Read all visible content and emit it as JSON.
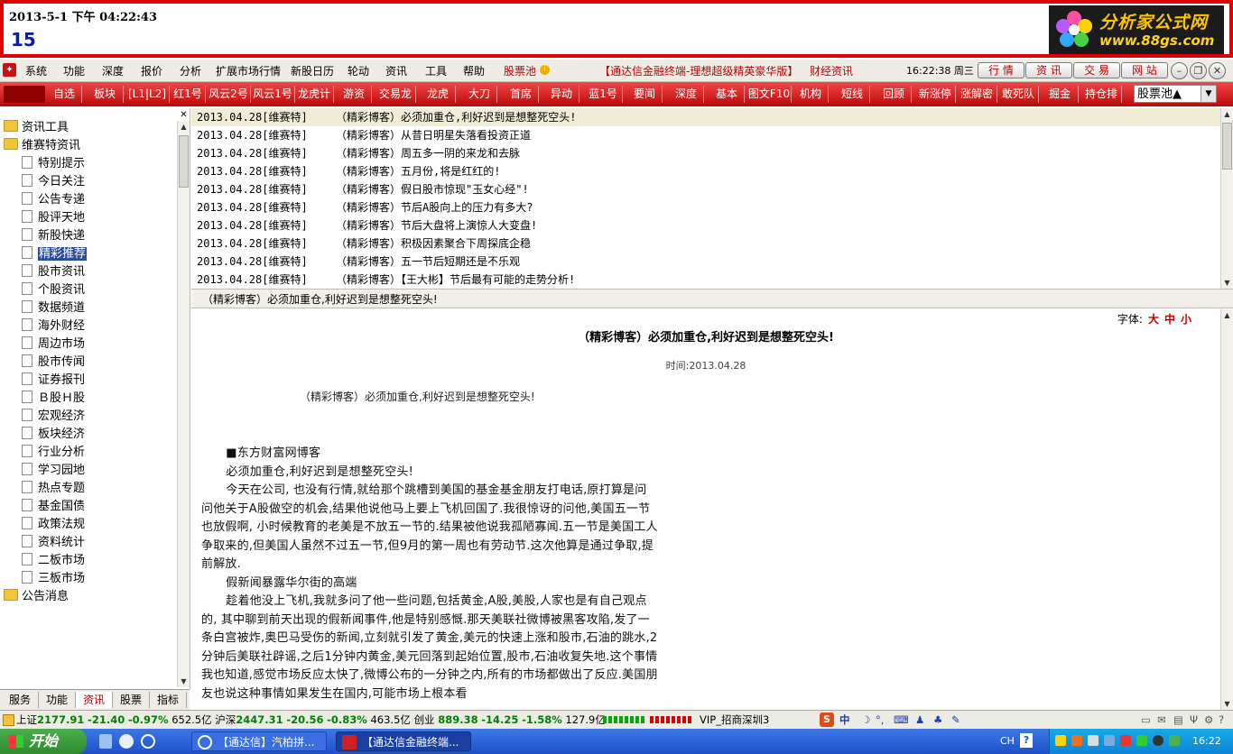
{
  "banner": {
    "datetime": "2013-5-1 下午 04:22:43",
    "number": "15",
    "logo_title": "分析家公式网",
    "logo_url": "www.88gs.com"
  },
  "menubar": {
    "items": [
      "系统",
      "功能",
      "深度",
      "报价",
      "分析",
      "扩展市场行情",
      "新股日历",
      "轮动",
      "资讯",
      "工具",
      "帮助"
    ],
    "stock_pool": "股票池",
    "app_title": "【通达信金融终端-理想超级精英豪华版】",
    "finance_news": "财经资讯",
    "clock": "16:22:38 周三",
    "nav": [
      "行 情",
      "资 讯",
      "交 易",
      "网 站"
    ]
  },
  "toolbar": {
    "items": [
      "自选",
      "板块",
      "[L1|L2]",
      "红1号",
      "风云2号",
      "风云1号",
      "龙虎计",
      "游资",
      "交易龙",
      "龙虎",
      "大刀",
      "首席",
      "异动",
      "蓝1号",
      "要闻",
      "深度",
      "基本",
      "图文F10",
      "机构",
      "短线",
      "回顾",
      "新涨停",
      "涨解密",
      "敢死队",
      "掘金",
      "持仓排"
    ],
    "stock_pool_dropdown": "股票池▲"
  },
  "tree": {
    "nodes": [
      {
        "label": "资讯工具",
        "type": "folder",
        "level": 0
      },
      {
        "label": "维赛特资讯",
        "type": "folder",
        "level": 0
      },
      {
        "label": "特别提示",
        "type": "doc",
        "level": 1
      },
      {
        "label": "今日关注",
        "type": "doc",
        "level": 1
      },
      {
        "label": "公告专递",
        "type": "doc",
        "level": 1
      },
      {
        "label": "股评天地",
        "type": "doc",
        "level": 1
      },
      {
        "label": "新股快递",
        "type": "doc",
        "level": 1
      },
      {
        "label": "精彩推荐",
        "type": "doc",
        "level": 1,
        "selected": true
      },
      {
        "label": "股市资讯",
        "type": "doc",
        "level": 1
      },
      {
        "label": "个股资讯",
        "type": "doc",
        "level": 1
      },
      {
        "label": "数据频道",
        "type": "doc",
        "level": 1
      },
      {
        "label": "海外财经",
        "type": "doc",
        "level": 1
      },
      {
        "label": "周边市场",
        "type": "doc",
        "level": 1
      },
      {
        "label": "股市传闻",
        "type": "doc",
        "level": 1
      },
      {
        "label": "证券报刊",
        "type": "doc",
        "level": 1
      },
      {
        "label": "Ｂ股Ｈ股",
        "type": "doc",
        "level": 1
      },
      {
        "label": "宏观经济",
        "type": "doc",
        "level": 1
      },
      {
        "label": "板块经济",
        "type": "doc",
        "level": 1
      },
      {
        "label": "行业分析",
        "type": "doc",
        "level": 1
      },
      {
        "label": "学习园地",
        "type": "doc",
        "level": 1
      },
      {
        "label": "热点专题",
        "type": "doc",
        "level": 1
      },
      {
        "label": "基金国债",
        "type": "doc",
        "level": 1
      },
      {
        "label": "政策法规",
        "type": "doc",
        "level": 1
      },
      {
        "label": "资料统计",
        "type": "doc",
        "level": 1
      },
      {
        "label": "二板市场",
        "type": "doc",
        "level": 1
      },
      {
        "label": "三板市场",
        "type": "doc",
        "level": 1
      },
      {
        "label": "公告消息",
        "type": "folder",
        "level": 0
      }
    ]
  },
  "bottom_tabs": [
    "服务",
    "功能",
    "资讯",
    "股票",
    "指标"
  ],
  "headlines": [
    {
      "date": "2013.04.28[维赛特]",
      "title": "（精彩博客）必须加重仓,利好迟到是想整死空头!"
    },
    {
      "date": "2013.04.28[维赛特]",
      "title": "（精彩博客）从昔日明星失落看投资正道"
    },
    {
      "date": "2013.04.28[维赛特]",
      "title": "（精彩博客）周五多一阴的来龙和去脉"
    },
    {
      "date": "2013.04.28[维赛特]",
      "title": "（精彩博客）五月份,将是红红的!"
    },
    {
      "date": "2013.04.28[维赛特]",
      "title": "（精彩博客）假日股市惊现\"玉女心经\"!"
    },
    {
      "date": "2013.04.28[维赛特]",
      "title": "（精彩博客）节后A股向上的压力有多大?"
    },
    {
      "date": "2013.04.28[维赛特]",
      "title": "（精彩博客）节后大盘将上演惊人大变盘!"
    },
    {
      "date": "2013.04.28[维赛特]",
      "title": "（精彩博客）积极因素聚合下周探底企稳"
    },
    {
      "date": "2013.04.28[维赛特]",
      "title": "（精彩博客）五一节后短期还是不乐观"
    },
    {
      "date": "2013.04.28[维赛特]",
      "title": "（精彩博客）【王大彬】节后最有可能的走势分析!"
    }
  ],
  "subbar_title": "（精彩博客）必须加重仓,利好迟到是想整死空头!",
  "article": {
    "font_label": "字体:",
    "font_sizes": [
      "大",
      "中",
      "小"
    ],
    "title": "（精彩博客）必须加重仓,利好迟到是想整死空头!",
    "time": "时间:2013.04.28",
    "subtitle": "（精彩博客）必须加重仓,利好迟到是想整死空头!",
    "paragraphs": [
      "■东方财富网博客",
      "必须加重仓,利好迟到是想整死空头!",
      "今天在公司, 也没有行情,就给那个跳槽到美国的基金基金朋友打电话,原打算是问问他关于A股做空的机会,结果他说他马上要上飞机回国了.我很惊讶的问他,美国五一节也放假啊, 小时候教育的老美是不放五一节的.结果被他说我孤陋寡闻.五一节是美国工人争取来的,但美国人虽然不过五一节,但9月的第一周也有劳动节.这次他算是通过争取,提前解放.",
      "假新闻暴露华尔街的高端",
      "趁着他没上飞机,我就多问了他一些问题,包括黄金,A股,美股,人家也是有自己观点的, 其中聊到前天出现的假新闻事件,他是特别感慨.那天美联社微博被黑客攻陷,发了一条白宫被炸,奥巴马受伤的新闻,立刻就引发了黄金,美元的快速上涨和股市,石油的跳水,2分钟后美联社辟谣,之后1分钟内黄金,美元回落到起始位置,股市,石油收复失地.这个事情我也知道,感觉市场反应太快了,微博公布的一分钟之内,所有的市场都做出了反应.美国朋友也说这种事情如果发生在国内,可能市场上根本看"
    ]
  },
  "status": {
    "sh_label": "上证",
    "sh_value": "2177.91",
    "sh_change": "-21.40",
    "sh_pct": "-0.97%",
    "sh_amount": "652.5亿",
    "sz_label": "沪深",
    "sz_value": "2447.31",
    "sz_change": "-20.56",
    "sz_pct": "-0.83%",
    "sz_amount": "463.5亿",
    "cy_label": "创业",
    "cy_value": "889.38",
    "cy_change": "-14.25",
    "cy_pct": "-1.58%",
    "cy_amount": "127.9亿",
    "server": "VIP_招商深圳3"
  },
  "taskbar": {
    "start": "开始",
    "tasks": [
      "【通达信】汽柏拼...",
      "【通达信金融终端..."
    ],
    "lang": "CH",
    "clock": "16:22"
  },
  "colors": {
    "banner_border": "#e00000",
    "toolbar_red": "#d01818",
    "accent_blue": "#0a1f9a",
    "up_red": "#c00000",
    "down_green": "#008000"
  }
}
